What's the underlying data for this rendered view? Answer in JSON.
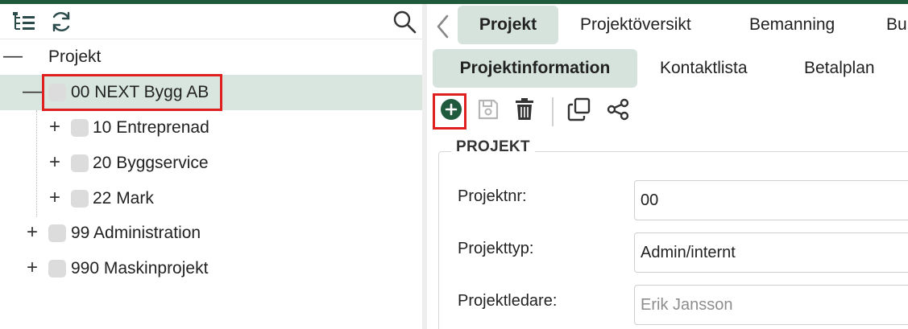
{
  "left_toolbar": {
    "tree_icon": "tree-structure-icon",
    "refresh_icon": "refresh-icon",
    "search_icon": "search-icon"
  },
  "tree": {
    "root_label": "Projekt",
    "items": [
      {
        "label": "00 NEXT Bygg AB",
        "toggle": "—",
        "selected": true
      },
      {
        "label": "10 Entreprenad",
        "toggle": "+"
      },
      {
        "label": "20 Byggservice",
        "toggle": "+"
      },
      {
        "label": "22 Mark",
        "toggle": "+"
      },
      {
        "label": "99 Administration",
        "toggle": "+"
      },
      {
        "label": "990 Maskinprojekt",
        "toggle": "+"
      }
    ],
    "root_toggle": "—"
  },
  "tabs": [
    {
      "label": "Projekt",
      "active": true
    },
    {
      "label": "Projektöversikt"
    },
    {
      "label": "Bemanning"
    },
    {
      "label": "Bu"
    }
  ],
  "subtabs": [
    {
      "label": "Projektinformation",
      "active": true
    },
    {
      "label": "Kontaktlista"
    },
    {
      "label": "Betalplan"
    }
  ],
  "actions": [
    "add-icon",
    "save-icon",
    "trash-icon",
    "copy-icon",
    "share-icon"
  ],
  "form": {
    "section_title": "PROJEKT",
    "fields": [
      {
        "label": "Projektnr:",
        "value": ""
      },
      {
        "label": "Projekttyp:",
        "value": ""
      },
      {
        "label": "Projektledare:",
        "placeholder": ""
      }
    ],
    "projektnr_value": "00",
    "projekttyp_value": "Admin/internt",
    "projektledare_placeholder": "Erik Jansson"
  },
  "colors": {
    "brand_green": "#1f5a3c",
    "selected_bg": "#d9e6e0",
    "tab_active_bg": "#d6e3dd",
    "highlight_red": "#e0201f"
  }
}
